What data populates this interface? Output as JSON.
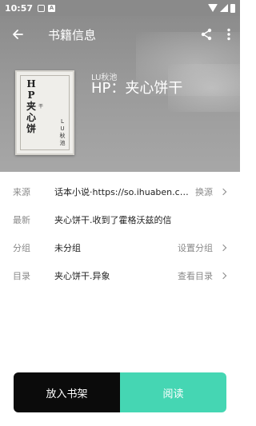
{
  "status_bar": {
    "time": "10:57",
    "a_icon_label": "A"
  },
  "toolbar": {
    "title": "书籍信息"
  },
  "cover": {
    "title_chars": [
      "H",
      "P",
      "夹",
      "心",
      "饼"
    ],
    "sub_char": "干",
    "author_chars": [
      "L",
      "U",
      "秋",
      "池"
    ]
  },
  "book": {
    "author": "LU秋池",
    "name": "HP：夹心饼干"
  },
  "info": {
    "source": {
      "label": "来源",
      "value": "话本小说·https://so.ihuaben.com",
      "action": "换源"
    },
    "latest": {
      "label": "最新",
      "value": "夹心饼干.收到了霍格沃兹的信"
    },
    "group": {
      "label": "分组",
      "value": "未分组",
      "action": "设置分组"
    },
    "toc": {
      "label": "目录",
      "value": "夹心饼干.异象",
      "action": "查看目录"
    }
  },
  "buttons": {
    "add_to_shelf": "放入书架",
    "read": "阅读"
  },
  "colors": {
    "accent": "#45d6b3",
    "dark_button": "#0b0b0b"
  }
}
